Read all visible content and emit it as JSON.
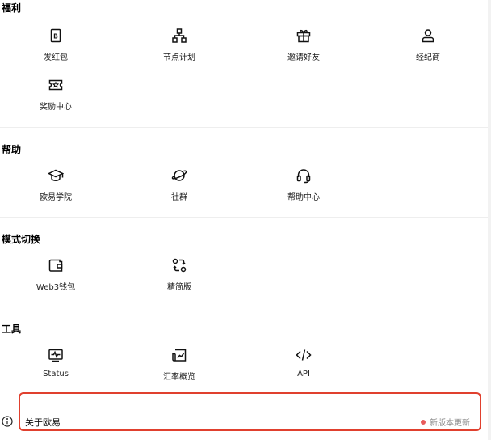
{
  "sections": {
    "benefits": {
      "title": "福利",
      "items": [
        {
          "label": "发红包",
          "icon": "red-packet-icon"
        },
        {
          "label": "节点计划",
          "icon": "node-network-icon"
        },
        {
          "label": "邀请好友",
          "icon": "gift-icon"
        },
        {
          "label": "经纪商",
          "icon": "person-icon"
        },
        {
          "label": "奖励中心",
          "icon": "ticket-star-icon"
        }
      ]
    },
    "help": {
      "title": "帮助",
      "items": [
        {
          "label": "欧易学院",
          "icon": "graduation-cap-icon"
        },
        {
          "label": "社群",
          "icon": "planet-icon"
        },
        {
          "label": "帮助中心",
          "icon": "headset-icon"
        }
      ]
    },
    "mode": {
      "title": "模式切换",
      "items": [
        {
          "label": "Web3钱包",
          "icon": "wallet-icon"
        },
        {
          "label": "精简版",
          "icon": "switch-arrows-icon"
        }
      ]
    },
    "tools": {
      "title": "工具",
      "items": [
        {
          "label": "Status",
          "icon": "pulse-monitor-icon"
        },
        {
          "label": "汇率概览",
          "icon": "trend-chart-icon"
        },
        {
          "label": "API",
          "icon": "code-icon"
        }
      ]
    }
  },
  "about": {
    "title": "关于欧易",
    "status": "新版本更新",
    "info_icon": "info-circle-icon",
    "highlight_color": "#e0402e",
    "dot_color": "#e85b5b"
  }
}
